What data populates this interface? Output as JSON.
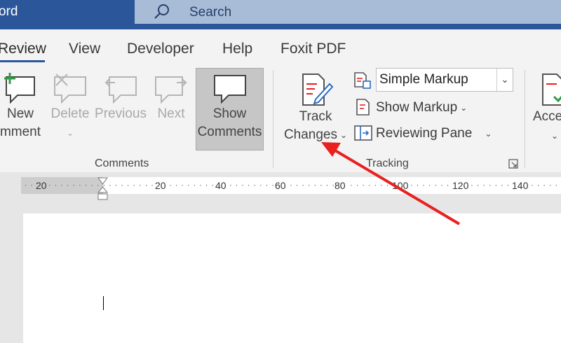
{
  "titlebar": {
    "app_name": "ord",
    "search_placeholder": "Search",
    "bg": "#2b579a"
  },
  "tabs": [
    {
      "label": "Review",
      "active": true
    },
    {
      "label": "View"
    },
    {
      "label": "Developer"
    },
    {
      "label": "Help"
    },
    {
      "label": "Foxit PDF"
    }
  ],
  "comments_group": {
    "label": "Comments",
    "new_comment": {
      "line1": "New",
      "line2": "mment"
    },
    "delete": {
      "label": "Delete",
      "enabled": false
    },
    "previous": {
      "label": "Previous",
      "enabled": false
    },
    "next": {
      "label": "Next",
      "enabled": false
    },
    "show_comments": {
      "line1": "Show",
      "line2": "Comments",
      "pressed": true
    }
  },
  "tracking_group": {
    "label": "Tracking",
    "track_changes": {
      "line1": "Track",
      "line2": "Changes"
    },
    "markup_select": {
      "value": "Simple Markup"
    },
    "show_markup": "Show Markup",
    "reviewing_pane": "Reviewing Pane"
  },
  "accessibility_group": {
    "label_partial": "Acce"
  },
  "ruler": {
    "labels": [
      "20",
      "20",
      "40",
      "60",
      "80",
      "100",
      "120",
      "140"
    ]
  },
  "annotation": {
    "arrow_color": "#e8201f"
  }
}
